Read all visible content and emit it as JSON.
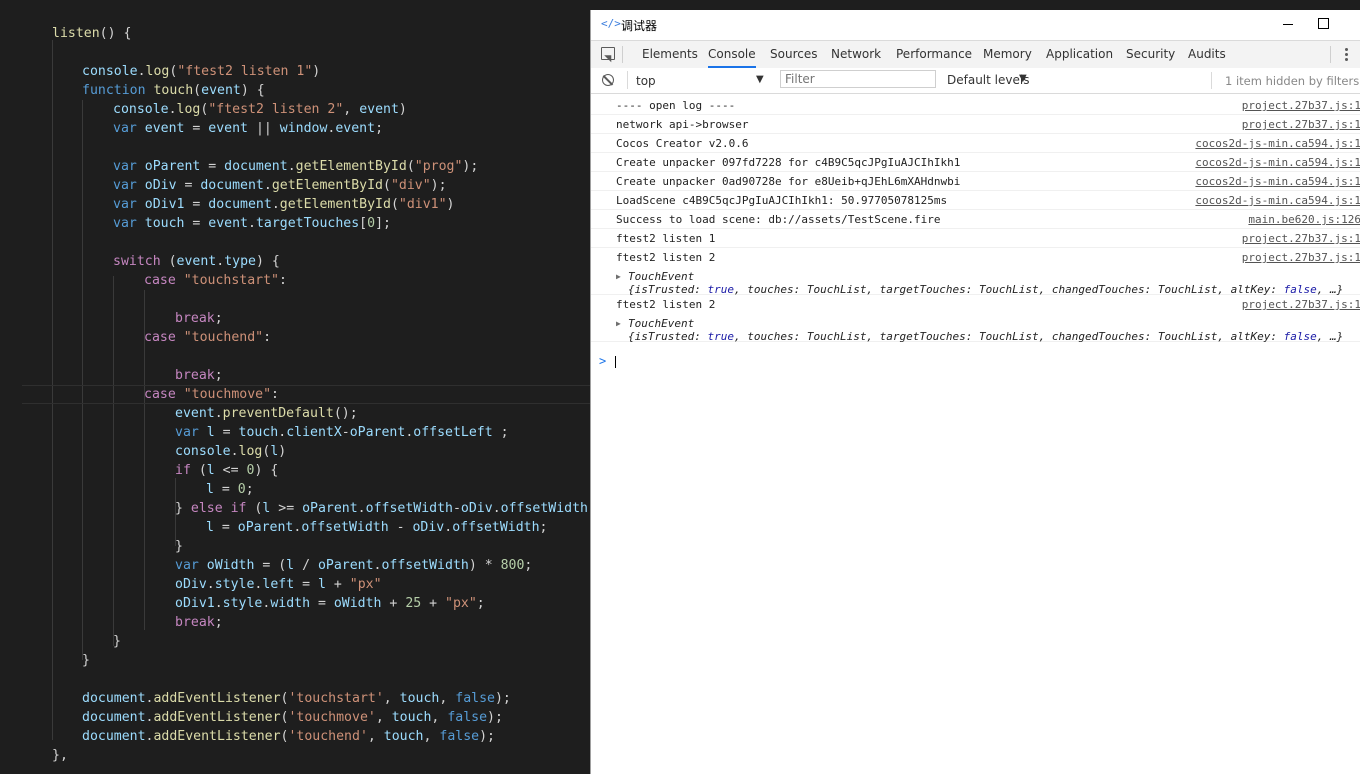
{
  "editor": {
    "lines": [
      {
        "segs": [
          {
            "t": "listen",
            "c": "f"
          },
          {
            "t": "() {",
            "c": "p"
          }
        ]
      },
      {
        "segs": []
      },
      {
        "segs": [
          {
            "t": "console",
            "c": "v"
          },
          {
            "t": ".",
            "c": "p"
          },
          {
            "t": "log",
            "c": "f"
          },
          {
            "t": "(",
            "c": "p"
          },
          {
            "t": "\"ftest2 listen 1\"",
            "c": "s"
          },
          {
            "t": ")",
            "c": "p"
          }
        ]
      },
      {
        "segs": [
          {
            "t": "function ",
            "c": "k"
          },
          {
            "t": "touch",
            "c": "f"
          },
          {
            "t": "(",
            "c": "p"
          },
          {
            "t": "event",
            "c": "v"
          },
          {
            "t": ") {",
            "c": "p"
          }
        ]
      },
      {
        "segs": [
          {
            "t": "console",
            "c": "v"
          },
          {
            "t": ".",
            "c": "p"
          },
          {
            "t": "log",
            "c": "f"
          },
          {
            "t": "(",
            "c": "p"
          },
          {
            "t": "\"ftest2 listen 2\"",
            "c": "s"
          },
          {
            "t": ", ",
            "c": "p"
          },
          {
            "t": "event",
            "c": "v"
          },
          {
            "t": ")",
            "c": "p"
          }
        ]
      },
      {
        "segs": [
          {
            "t": "var ",
            "c": "k"
          },
          {
            "t": "event",
            "c": "v"
          },
          {
            "t": " = ",
            "c": "p"
          },
          {
            "t": "event",
            "c": "v"
          },
          {
            "t": " || ",
            "c": "p"
          },
          {
            "t": "window",
            "c": "v"
          },
          {
            "t": ".",
            "c": "p"
          },
          {
            "t": "event",
            "c": "v"
          },
          {
            "t": ";",
            "c": "p"
          }
        ]
      },
      {
        "segs": []
      },
      {
        "segs": [
          {
            "t": "var ",
            "c": "k"
          },
          {
            "t": "oParent",
            "c": "v"
          },
          {
            "t": " = ",
            "c": "p"
          },
          {
            "t": "document",
            "c": "v"
          },
          {
            "t": ".",
            "c": "p"
          },
          {
            "t": "getElementById",
            "c": "f"
          },
          {
            "t": "(",
            "c": "p"
          },
          {
            "t": "\"prog\"",
            "c": "s"
          },
          {
            "t": ");",
            "c": "p"
          }
        ]
      },
      {
        "segs": [
          {
            "t": "var ",
            "c": "k"
          },
          {
            "t": "oDiv",
            "c": "v"
          },
          {
            "t": " = ",
            "c": "p"
          },
          {
            "t": "document",
            "c": "v"
          },
          {
            "t": ".",
            "c": "p"
          },
          {
            "t": "getElementById",
            "c": "f"
          },
          {
            "t": "(",
            "c": "p"
          },
          {
            "t": "\"div\"",
            "c": "s"
          },
          {
            "t": ");",
            "c": "p"
          }
        ]
      },
      {
        "segs": [
          {
            "t": "var ",
            "c": "k"
          },
          {
            "t": "oDiv1",
            "c": "v"
          },
          {
            "t": " = ",
            "c": "p"
          },
          {
            "t": "document",
            "c": "v"
          },
          {
            "t": ".",
            "c": "p"
          },
          {
            "t": "getElementById",
            "c": "f"
          },
          {
            "t": "(",
            "c": "p"
          },
          {
            "t": "\"div1\"",
            "c": "s"
          },
          {
            "t": ")",
            "c": "p"
          }
        ]
      },
      {
        "segs": [
          {
            "t": "var ",
            "c": "k"
          },
          {
            "t": "touch",
            "c": "v"
          },
          {
            "t": " = ",
            "c": "p"
          },
          {
            "t": "event",
            "c": "v"
          },
          {
            "t": ".",
            "c": "p"
          },
          {
            "t": "targetTouches",
            "c": "v"
          },
          {
            "t": "[",
            "c": "p"
          },
          {
            "t": "0",
            "c": "n"
          },
          {
            "t": "];",
            "c": "p"
          }
        ]
      },
      {
        "segs": []
      },
      {
        "segs": [
          {
            "t": "switch ",
            "c": "c"
          },
          {
            "t": "(",
            "c": "p"
          },
          {
            "t": "event",
            "c": "v"
          },
          {
            "t": ".",
            "c": "p"
          },
          {
            "t": "type",
            "c": "v"
          },
          {
            "t": ") {",
            "c": "p"
          }
        ]
      },
      {
        "segs": [
          {
            "t": "case ",
            "c": "c"
          },
          {
            "t": "\"touchstart\"",
            "c": "s"
          },
          {
            "t": ":",
            "c": "p"
          }
        ]
      },
      {
        "segs": []
      },
      {
        "segs": [
          {
            "t": "break",
            "c": "c"
          },
          {
            "t": ";",
            "c": "p"
          }
        ]
      },
      {
        "segs": [
          {
            "t": "case ",
            "c": "c"
          },
          {
            "t": "\"touchend\"",
            "c": "s"
          },
          {
            "t": ":",
            "c": "p"
          }
        ]
      },
      {
        "segs": []
      },
      {
        "segs": [
          {
            "t": "break",
            "c": "c"
          },
          {
            "t": ";",
            "c": "p"
          }
        ]
      },
      {
        "segs": [
          {
            "t": "case ",
            "c": "c"
          },
          {
            "t": "\"touchmove\"",
            "c": "s"
          },
          {
            "t": ":",
            "c": "p"
          }
        ]
      },
      {
        "segs": [
          {
            "t": "event",
            "c": "v"
          },
          {
            "t": ".",
            "c": "p"
          },
          {
            "t": "preventDefault",
            "c": "f"
          },
          {
            "t": "();",
            "c": "p"
          }
        ]
      },
      {
        "segs": [
          {
            "t": "var ",
            "c": "k"
          },
          {
            "t": "l",
            "c": "v"
          },
          {
            "t": " = ",
            "c": "p"
          },
          {
            "t": "touch",
            "c": "v"
          },
          {
            "t": ".",
            "c": "p"
          },
          {
            "t": "clientX",
            "c": "v"
          },
          {
            "t": "-",
            "c": "p"
          },
          {
            "t": "oParent",
            "c": "v"
          },
          {
            "t": ".",
            "c": "p"
          },
          {
            "t": "offsetLeft",
            "c": "v"
          },
          {
            "t": " ;",
            "c": "p"
          }
        ]
      },
      {
        "segs": [
          {
            "t": "console",
            "c": "v"
          },
          {
            "t": ".",
            "c": "p"
          },
          {
            "t": "log",
            "c": "f"
          },
          {
            "t": "(",
            "c": "p"
          },
          {
            "t": "l",
            "c": "v"
          },
          {
            "t": ")",
            "c": "p"
          }
        ]
      },
      {
        "segs": [
          {
            "t": "if ",
            "c": "c"
          },
          {
            "t": "(",
            "c": "p"
          },
          {
            "t": "l",
            "c": "v"
          },
          {
            "t": " <= ",
            "c": "p"
          },
          {
            "t": "0",
            "c": "n"
          },
          {
            "t": ") {",
            "c": "p"
          }
        ]
      },
      {
        "segs": [
          {
            "t": "l",
            "c": "v"
          },
          {
            "t": " = ",
            "c": "p"
          },
          {
            "t": "0",
            "c": "n"
          },
          {
            "t": ";",
            "c": "p"
          }
        ]
      },
      {
        "segs": [
          {
            "t": "} ",
            "c": "p"
          },
          {
            "t": "else if ",
            "c": "c"
          },
          {
            "t": "(",
            "c": "p"
          },
          {
            "t": "l",
            "c": "v"
          },
          {
            "t": " >= ",
            "c": "p"
          },
          {
            "t": "oParent",
            "c": "v"
          },
          {
            "t": ".",
            "c": "p"
          },
          {
            "t": "offsetWidth",
            "c": "v"
          },
          {
            "t": "-",
            "c": "p"
          },
          {
            "t": "oDiv",
            "c": "v"
          },
          {
            "t": ".",
            "c": "p"
          },
          {
            "t": "offsetWidth",
            "c": "v"
          },
          {
            "t": ")",
            "c": "p"
          }
        ]
      },
      {
        "segs": [
          {
            "t": "l",
            "c": "v"
          },
          {
            "t": " = ",
            "c": "p"
          },
          {
            "t": "oParent",
            "c": "v"
          },
          {
            "t": ".",
            "c": "p"
          },
          {
            "t": "offsetWidth",
            "c": "v"
          },
          {
            "t": " - ",
            "c": "p"
          },
          {
            "t": "oDiv",
            "c": "v"
          },
          {
            "t": ".",
            "c": "p"
          },
          {
            "t": "offsetWidth",
            "c": "v"
          },
          {
            "t": ";",
            "c": "p"
          }
        ]
      },
      {
        "segs": [
          {
            "t": "}",
            "c": "p"
          }
        ]
      },
      {
        "segs": [
          {
            "t": "var ",
            "c": "k"
          },
          {
            "t": "oWidth",
            "c": "v"
          },
          {
            "t": " = (",
            "c": "p"
          },
          {
            "t": "l",
            "c": "v"
          },
          {
            "t": " / ",
            "c": "p"
          },
          {
            "t": "oParent",
            "c": "v"
          },
          {
            "t": ".",
            "c": "p"
          },
          {
            "t": "offsetWidth",
            "c": "v"
          },
          {
            "t": ") * ",
            "c": "p"
          },
          {
            "t": "800",
            "c": "n"
          },
          {
            "t": ";",
            "c": "p"
          }
        ]
      },
      {
        "segs": [
          {
            "t": "oDiv",
            "c": "v"
          },
          {
            "t": ".",
            "c": "p"
          },
          {
            "t": "style",
            "c": "v"
          },
          {
            "t": ".",
            "c": "p"
          },
          {
            "t": "left",
            "c": "v"
          },
          {
            "t": " = ",
            "c": "p"
          },
          {
            "t": "l",
            "c": "v"
          },
          {
            "t": " + ",
            "c": "p"
          },
          {
            "t": "\"px\"",
            "c": "s"
          }
        ]
      },
      {
        "segs": [
          {
            "t": "oDiv1",
            "c": "v"
          },
          {
            "t": ".",
            "c": "p"
          },
          {
            "t": "style",
            "c": "v"
          },
          {
            "t": ".",
            "c": "p"
          },
          {
            "t": "width",
            "c": "v"
          },
          {
            "t": " = ",
            "c": "p"
          },
          {
            "t": "oWidth",
            "c": "v"
          },
          {
            "t": " + ",
            "c": "p"
          },
          {
            "t": "25",
            "c": "n"
          },
          {
            "t": " + ",
            "c": "p"
          },
          {
            "t": "\"px\"",
            "c": "s"
          },
          {
            "t": ";",
            "c": "p"
          }
        ]
      },
      {
        "segs": [
          {
            "t": "break",
            "c": "c"
          },
          {
            "t": ";",
            "c": "p"
          }
        ]
      },
      {
        "segs": [
          {
            "t": "}",
            "c": "p"
          }
        ]
      },
      {
        "segs": [
          {
            "t": "}",
            "c": "p"
          }
        ]
      },
      {
        "segs": []
      },
      {
        "segs": [
          {
            "t": "document",
            "c": "v"
          },
          {
            "t": ".",
            "c": "p"
          },
          {
            "t": "addEventListener",
            "c": "f"
          },
          {
            "t": "(",
            "c": "p"
          },
          {
            "t": "'touchstart'",
            "c": "s"
          },
          {
            "t": ", ",
            "c": "p"
          },
          {
            "t": "touch",
            "c": "v"
          },
          {
            "t": ", ",
            "c": "p"
          },
          {
            "t": "false",
            "c": "k"
          },
          {
            "t": ");",
            "c": "p"
          }
        ]
      },
      {
        "segs": [
          {
            "t": "document",
            "c": "v"
          },
          {
            "t": ".",
            "c": "p"
          },
          {
            "t": "addEventListener",
            "c": "f"
          },
          {
            "t": "(",
            "c": "p"
          },
          {
            "t": "'touchmove'",
            "c": "s"
          },
          {
            "t": ", ",
            "c": "p"
          },
          {
            "t": "touch",
            "c": "v"
          },
          {
            "t": ", ",
            "c": "p"
          },
          {
            "t": "false",
            "c": "k"
          },
          {
            "t": ");",
            "c": "p"
          }
        ]
      },
      {
        "segs": [
          {
            "t": "document",
            "c": "v"
          },
          {
            "t": ".",
            "c": "p"
          },
          {
            "t": "addEventListener",
            "c": "f"
          },
          {
            "t": "(",
            "c": "p"
          },
          {
            "t": "'touchend'",
            "c": "s"
          },
          {
            "t": ", ",
            "c": "p"
          },
          {
            "t": "touch",
            "c": "v"
          },
          {
            "t": ", ",
            "c": "p"
          },
          {
            "t": "false",
            "c": "k"
          },
          {
            "t": ");",
            "c": "p"
          }
        ]
      },
      {
        "segs": [
          {
            "t": "},",
            "c": "p"
          }
        ]
      }
    ]
  },
  "devtools": {
    "window_title": "调试器",
    "window_icon": "code-brackets-icon",
    "tabs": [
      "Elements",
      "Console",
      "Sources",
      "Network",
      "Performance",
      "Memory",
      "Application",
      "Security",
      "Audits"
    ],
    "active_tab": "Console",
    "context": "top",
    "filter_placeholder": "Filter",
    "levels": "Default levels",
    "hidden_info": "1 item hidden by filters",
    "messages": [
      {
        "text": "---- open log ----",
        "src": "project.27b37.js:1"
      },
      {
        "text": "network api->browser",
        "src": "project.27b37.js:1"
      },
      {
        "text": "Cocos Creator v2.0.6",
        "src": "cocos2d-js-min.ca594.js:1"
      },
      {
        "text": "Create unpacker 097fd7228 for c4B9C5qcJPgIuAJCIhIkh1",
        "src": "cocos2d-js-min.ca594.js:1"
      },
      {
        "text": "Create unpacker 0ad90728e for e8Ueib+qJEhL6mXAHdnwbi",
        "src": "cocos2d-js-min.ca594.js:1"
      },
      {
        "text": "LoadScene c4B9C5qcJPgIuAJCIhIkh1: 50.97705078125ms",
        "src": "cocos2d-js-min.ca594.js:1"
      },
      {
        "text": "Success to load scene: db://assets/TestScene.fire",
        "src": "main.be620.js:126"
      },
      {
        "text": "ftest2 listen 1",
        "src": "project.27b37.js:1"
      },
      {
        "text": "ftest2 listen 2",
        "src": "project.27b37.js:1",
        "obj": {
          "name": "TouchEvent",
          "body": "{isTrusted: true, touches: TouchList, targetTouches: TouchList, changedTouches: TouchList, altKey: false, …}"
        }
      },
      {
        "text": "ftest2 listen 2",
        "src": "project.27b37.js:1",
        "obj": {
          "name": "TouchEvent",
          "body": "{isTrusted: true, touches: TouchList, targetTouches: TouchList, changedTouches: TouchList, altKey: false, …}"
        }
      }
    ],
    "prompt_symbol": ">"
  }
}
